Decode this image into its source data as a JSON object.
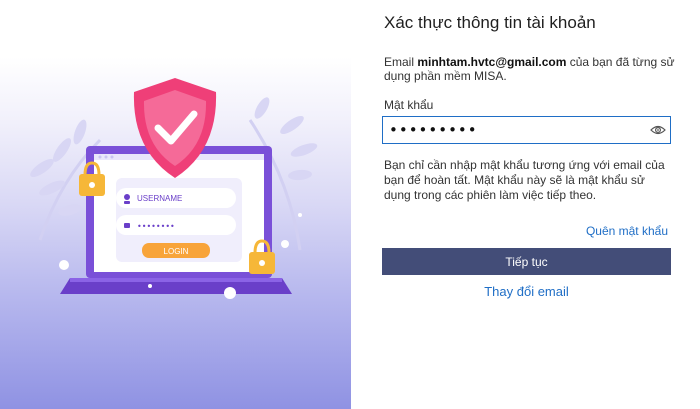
{
  "illustration": {
    "username_label": "USERNAME",
    "login_button_label": "LOGIN",
    "password_mask": "••••••••"
  },
  "form": {
    "title": "Xác thực thông tin tài khoản",
    "desc_prefix": "Email ",
    "email": "minhtam.hvtc@gmail.com",
    "desc_suffix": " của bạn đã từng sử dụng phần mềm MISA.",
    "password_label": "Mật khẩu",
    "password_value": "•••••••••",
    "password_toggle_icon": "eye-icon",
    "note": "Bạn chỉ cần nhập mật khẩu tương ứng với email của bạn để hoàn tất. Mật khẩu này sẽ là mật khẩu sử dụng trong các phiên làm việc tiếp theo.",
    "forgot_password": "Quên mật khẩu",
    "continue_button": "Tiếp tục",
    "change_email": "Thay đổi email"
  },
  "colors": {
    "primary_button": "#434d78",
    "link": "#1f6ec6",
    "input_border": "#1f6ec6",
    "shield": "#ef3f78",
    "laptop": "#7a50d8",
    "lock": "#f6b738"
  }
}
